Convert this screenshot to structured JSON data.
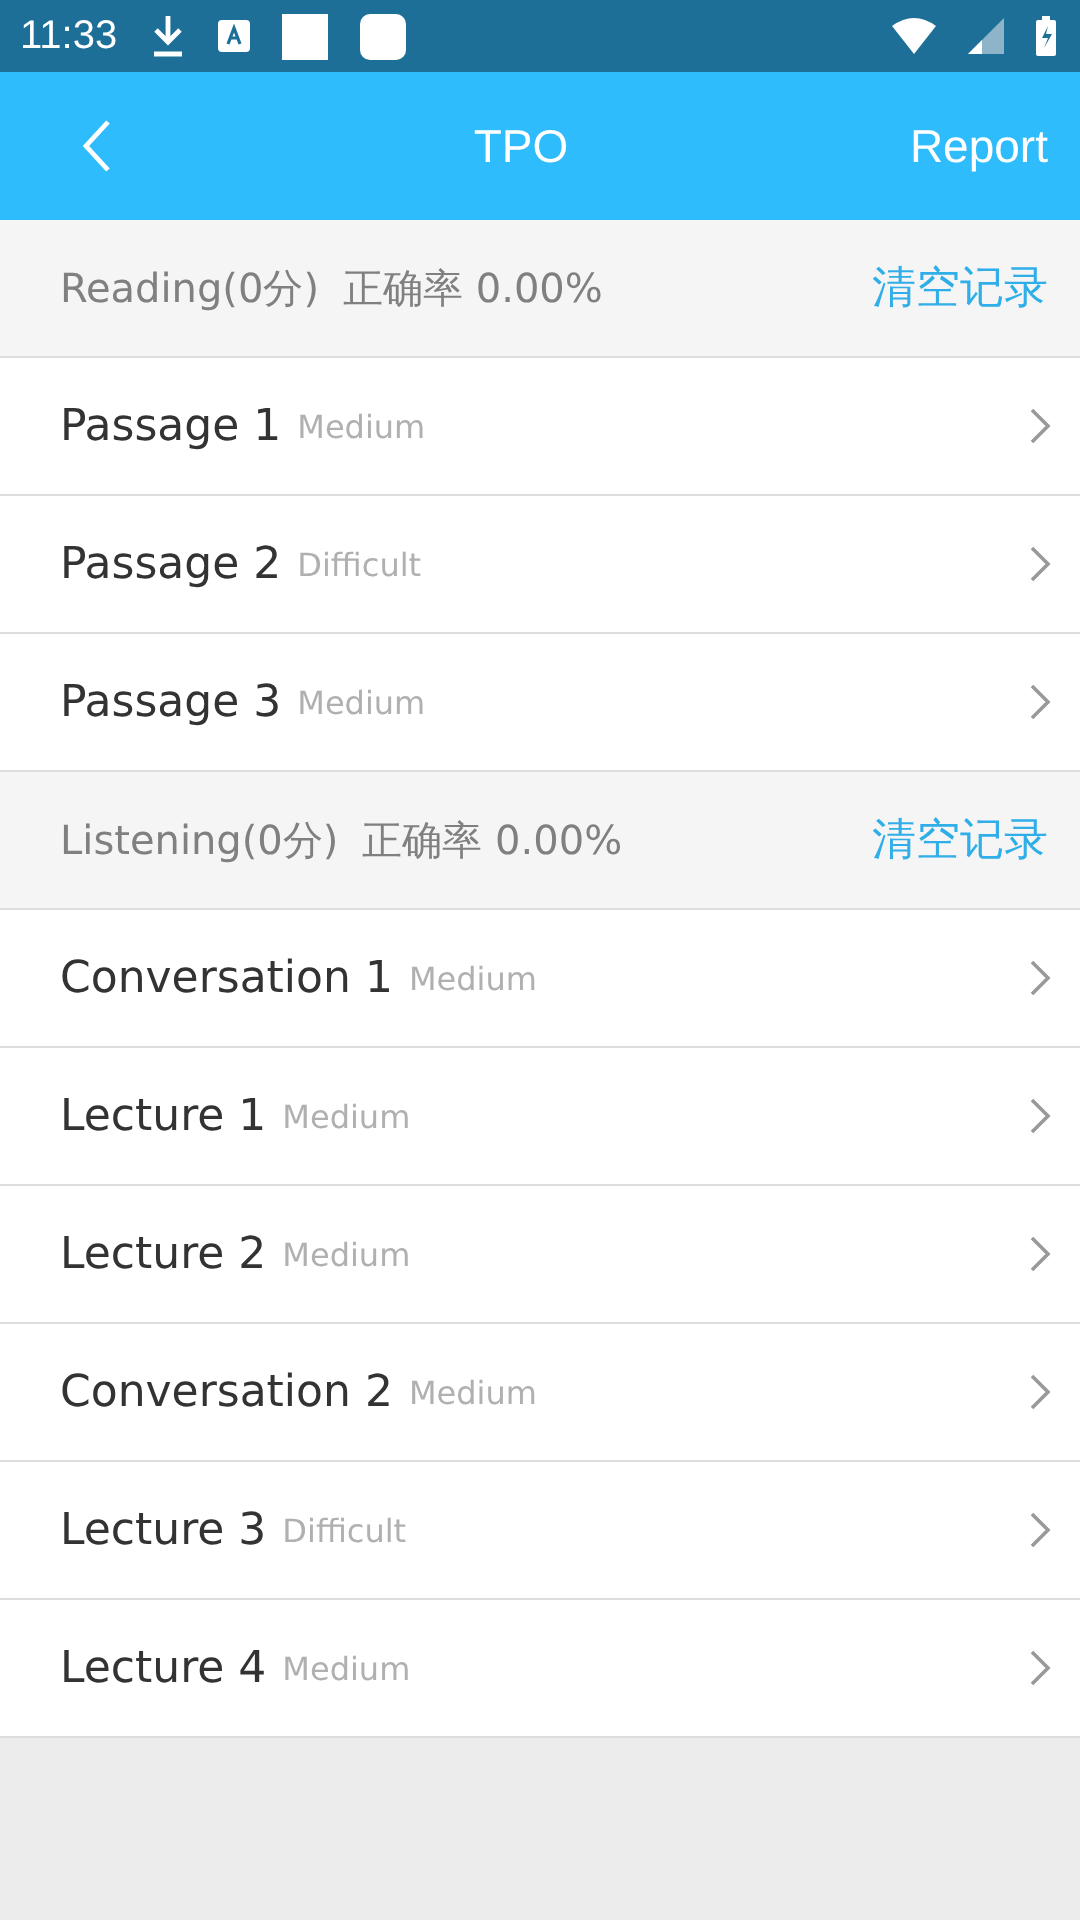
{
  "status_bar": {
    "time": "11:33"
  },
  "app_bar": {
    "title": "TPO",
    "action": "Report"
  },
  "sections": [
    {
      "title": "Reading(0分)",
      "accuracy": "正确率 0.00%",
      "action": "清空记录",
      "items": [
        {
          "title": "Passage 1",
          "difficulty": "Medium"
        },
        {
          "title": "Passage 2",
          "difficulty": "Difficult"
        },
        {
          "title": "Passage 3",
          "difficulty": "Medium"
        }
      ]
    },
    {
      "title": "Listening(0分)",
      "accuracy": "正确率 0.00%",
      "action": "清空记录",
      "items": [
        {
          "title": "Conversation 1",
          "difficulty": "Medium"
        },
        {
          "title": "Lecture 1",
          "difficulty": "Medium"
        },
        {
          "title": "Lecture 2",
          "difficulty": "Medium"
        },
        {
          "title": "Conversation 2",
          "difficulty": "Medium"
        },
        {
          "title": "Lecture 3",
          "difficulty": "Difficult"
        },
        {
          "title": "Lecture 4",
          "difficulty": "Medium"
        }
      ]
    }
  ]
}
